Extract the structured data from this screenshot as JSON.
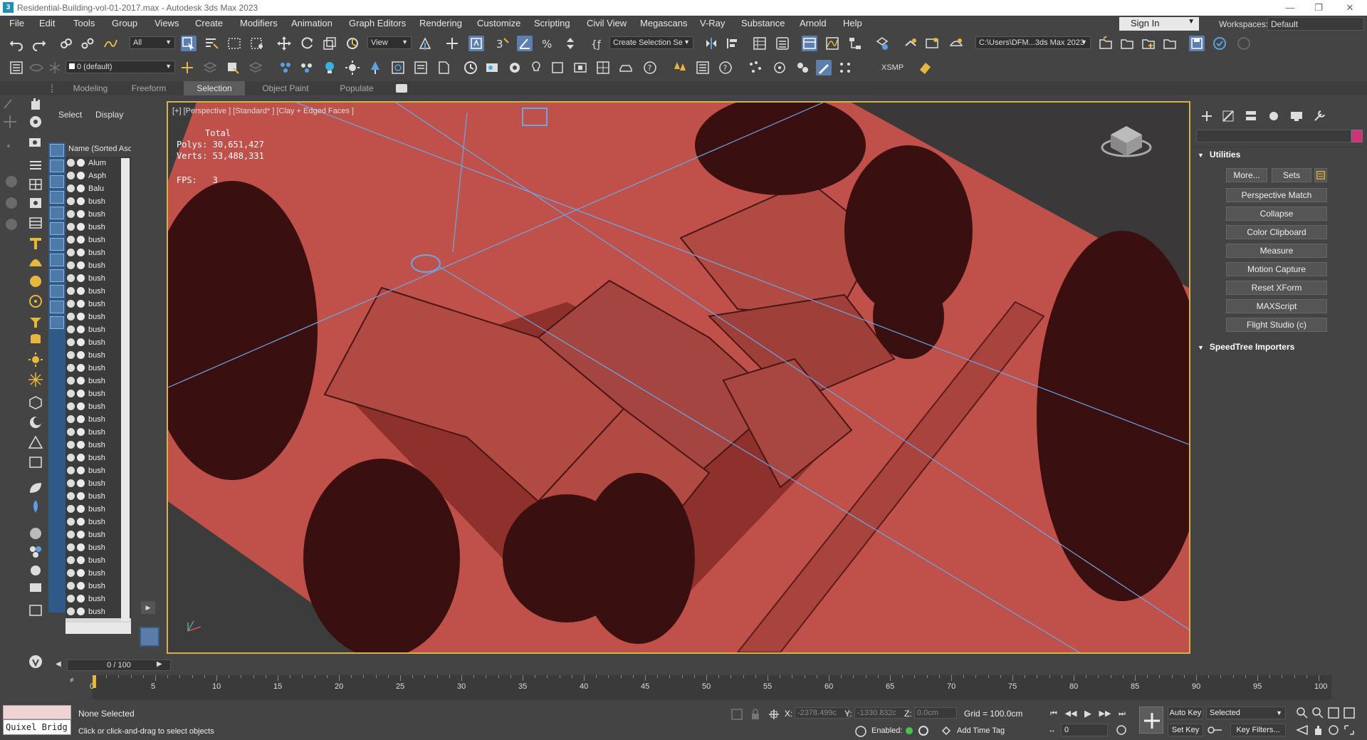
{
  "window": {
    "title": "Residential-Building-vol-01-2017.max - Autodesk 3ds Max 2023",
    "app_icon": "3"
  },
  "menu": [
    "File",
    "Edit",
    "Tools",
    "Group",
    "Views",
    "Create",
    "Modifiers",
    "Animation",
    "Graph Editors",
    "Rendering",
    "Customize",
    "Scripting",
    "Civil View",
    "Megascans",
    "V-Ray",
    "Substance",
    "Arnold",
    "Help"
  ],
  "signin": "Sign In",
  "workspaces": {
    "label": "Workspaces:",
    "value": "Default"
  },
  "toolbar1": {
    "filter_dropdown": "All",
    "view_dropdown": "View",
    "selection_set": "Create Selection Se",
    "project_path": "C:\\Users\\DFM...3ds Max 2023"
  },
  "toolbar2": {
    "layer_dropdown": "0 (default)",
    "xsmp_label": "XSMP"
  },
  "ribbon_tabs": [
    {
      "label": "Modeling",
      "active": false
    },
    {
      "label": "Freeform",
      "active": false
    },
    {
      "label": "Selection",
      "active": true
    },
    {
      "label": "Object Paint",
      "active": false
    },
    {
      "label": "Populate",
      "active": false
    }
  ],
  "explorer": {
    "tab_select": "Select",
    "tab_display": "Display",
    "column_header": "Name (Sorted Asce",
    "rows": [
      "Alum",
      "Asph",
      "Balu",
      "bush",
      "bush",
      "bush",
      "bush",
      "bush",
      "bush",
      "bush",
      "bush",
      "bush",
      "bush",
      "bush",
      "bush",
      "bush",
      "bush",
      "bush",
      "bush",
      "bush",
      "bush",
      "bush",
      "bush",
      "bush",
      "bush",
      "bush",
      "bush",
      "bush",
      "bush",
      "bush",
      "bush",
      "bush",
      "bush",
      "bush",
      "bush",
      "bush"
    ]
  },
  "viewport": {
    "label": "[+] [Perspective ] [Standard* ] [Clay + Edged Faces ]",
    "stats": {
      "total_label": "Total",
      "polys_label": "Polys:",
      "polys": "30,651,427",
      "verts_label": "Verts:",
      "verts": "53,488,331",
      "fps_label": "FPS:",
      "fps": "3"
    },
    "colors": {
      "ground": "#c0504a",
      "roof": "#b24a44",
      "trees": "#3a0f0f",
      "lines": "#6aa7e6"
    }
  },
  "command_panel": {
    "utilities_title": "Utilities",
    "more_button": "More...",
    "sets_button": "Sets",
    "buttons": [
      "Perspective Match",
      "Collapse",
      "Color Clipboard",
      "Measure",
      "Motion Capture",
      "Reset XForm",
      "MAXScript",
      "Flight Studio (c)"
    ],
    "speedtree_title": "SpeedTree Importers"
  },
  "timeline": {
    "frame_label": "0 / 100",
    "ticks": [
      "0",
      "5",
      "10",
      "15",
      "20",
      "25",
      "30",
      "35",
      "40",
      "45",
      "50",
      "55",
      "60",
      "65",
      "70",
      "75",
      "80",
      "85",
      "90",
      "95",
      "100"
    ]
  },
  "status": {
    "quixel_label": "Quixel Bridg",
    "selection": "None Selected",
    "prompt": "Click or click-and-drag to select objects",
    "x_label": "X:",
    "x_value": "-2378.499c",
    "y_label": "Y:",
    "y_value": "-1330.832c",
    "z_label": "Z:",
    "z_value": "0.0cm",
    "grid": "Grid = 100.0cm",
    "enabled_label": "Enabled:",
    "add_time_tag": "Add Time Tag",
    "auto_key": "Auto Key",
    "set_key": "Set Key",
    "selected_dropdown": "Selected",
    "key_filters": "Key Filters...",
    "frame_field": "0"
  }
}
